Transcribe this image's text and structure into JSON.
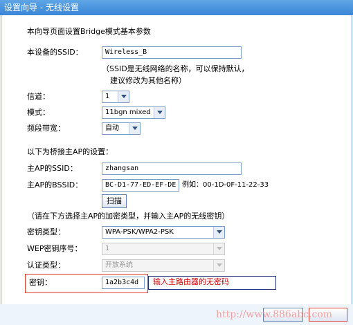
{
  "window": {
    "title": "设置向导 - 无线设置"
  },
  "intro": "本向导页面设置Bridge模式基本参数",
  "ssid": {
    "label": "本设备的SSID：",
    "value": "Wireless_B",
    "note_line1": "（SSID是无线网络的名称，可以保持默认，",
    "note_line2": "建议修改为其他名称）"
  },
  "channel": {
    "label": "信道：",
    "value": "1"
  },
  "mode": {
    "label": "模式：",
    "value": "11bgn mixed"
  },
  "bandwidth": {
    "label": "频段带宽：",
    "value": "自动"
  },
  "bridge_section": "以下为桥接主AP的设置：",
  "host_ssid": {
    "label": "主AP的SSID：",
    "value": "zhangsan"
  },
  "host_bssid": {
    "label": "主AP的BSSID：",
    "value": "BC-D1-77-ED-EF-DE",
    "example": "例如：00-1D-0F-11-22-33"
  },
  "scan_button": "扫描",
  "encrypt_prompt": "（请在下方选择主AP的加密类型，并输入主AP的无线密钥）",
  "key_type": {
    "label": "密钥类型：",
    "value": "WPA-PSK/WPA2-PSK"
  },
  "wep_index": {
    "label": "WEP密钥序号：",
    "value": "1"
  },
  "auth_type": {
    "label": "认证类型：",
    "value": "开放系统"
  },
  "key": {
    "label": "密钥：",
    "value": "1a2b3c4d",
    "hint": "输入主路由器的无密码"
  },
  "watermark": "http://www.886abc.com",
  "colors": {
    "title_bar": "#3a86d6",
    "highlight_red": "#e03a2c",
    "hint_red": "#d40000",
    "watermark": "#f5a0a0"
  }
}
